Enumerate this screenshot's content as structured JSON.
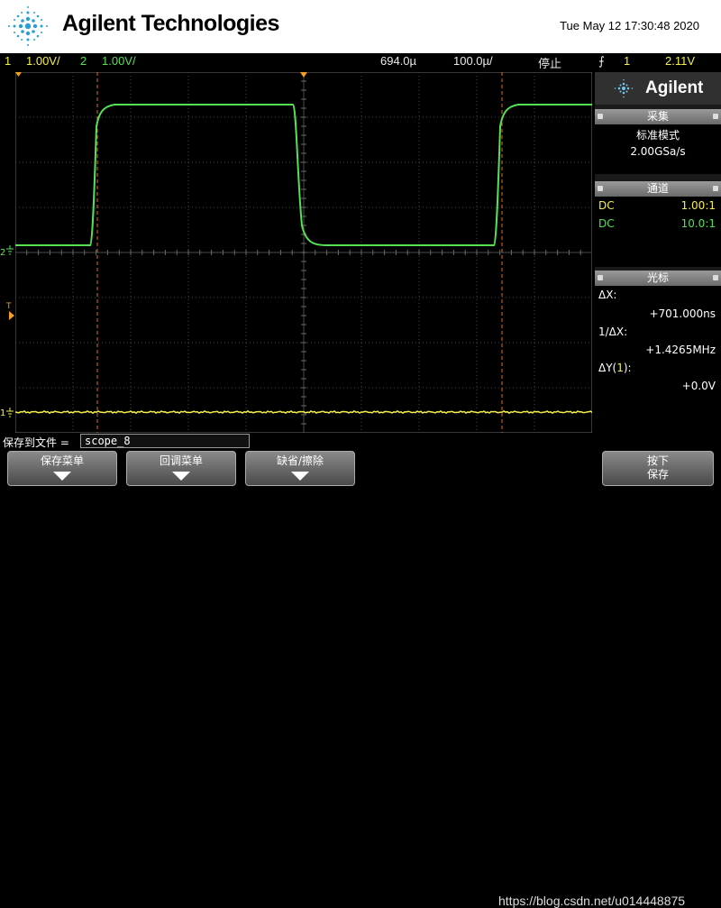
{
  "header": {
    "brand": "Agilent Technologies",
    "datetime": "Tue May 12 17:30:48 2020"
  },
  "status_bar": {
    "ch1_num": "1",
    "ch1_scale": "1.00V/",
    "ch2_num": "2",
    "ch2_scale": "1.00V/",
    "time_delay": "694.0µ",
    "time_scale": "100.0µ/",
    "run_state": "停止",
    "trigger_icon": "⨍",
    "trigger_channel": "1",
    "trigger_level": "2.11V"
  },
  "screen": {
    "ch2_marker": "2",
    "ch1_marker": "1",
    "trig_marker": "T"
  },
  "sidebar": {
    "logo": "Agilent",
    "acquire": {
      "title": "采集",
      "mode": "标准模式",
      "rate": "2.00GSa/s"
    },
    "channels": {
      "title": "通道",
      "rows": [
        {
          "coupling": "DC",
          "probe": "1.00:1"
        },
        {
          "coupling": "DC",
          "probe": "10.0:1"
        }
      ]
    },
    "cursors": {
      "title": "光标",
      "dx_label": "ΔX:",
      "dx_value": "+701.000ns",
      "inv_label": "1/ΔX:",
      "inv_value": "+1.4265MHz",
      "dy_label_pre": "ΔY(",
      "dy_label_ch": "1",
      "dy_label_post": "):",
      "dy_value": "+0.0V"
    }
  },
  "bottom": {
    "save_label": "保存到文件 =",
    "save_file": "scope_8",
    "softkeys": [
      {
        "label": "保存菜单"
      },
      {
        "label": "回调菜单"
      },
      {
        "label": "缺省/擦除"
      },
      {
        "label": "按下"
      }
    ],
    "softkey4_line2": "保存",
    "watermark": "https://blog.csdn.net/u014448875"
  },
  "colors": {
    "ch1": "#f5f04a",
    "ch2": "#56e056",
    "grid": "#4a4a4a",
    "cursor": "#e07020"
  }
}
